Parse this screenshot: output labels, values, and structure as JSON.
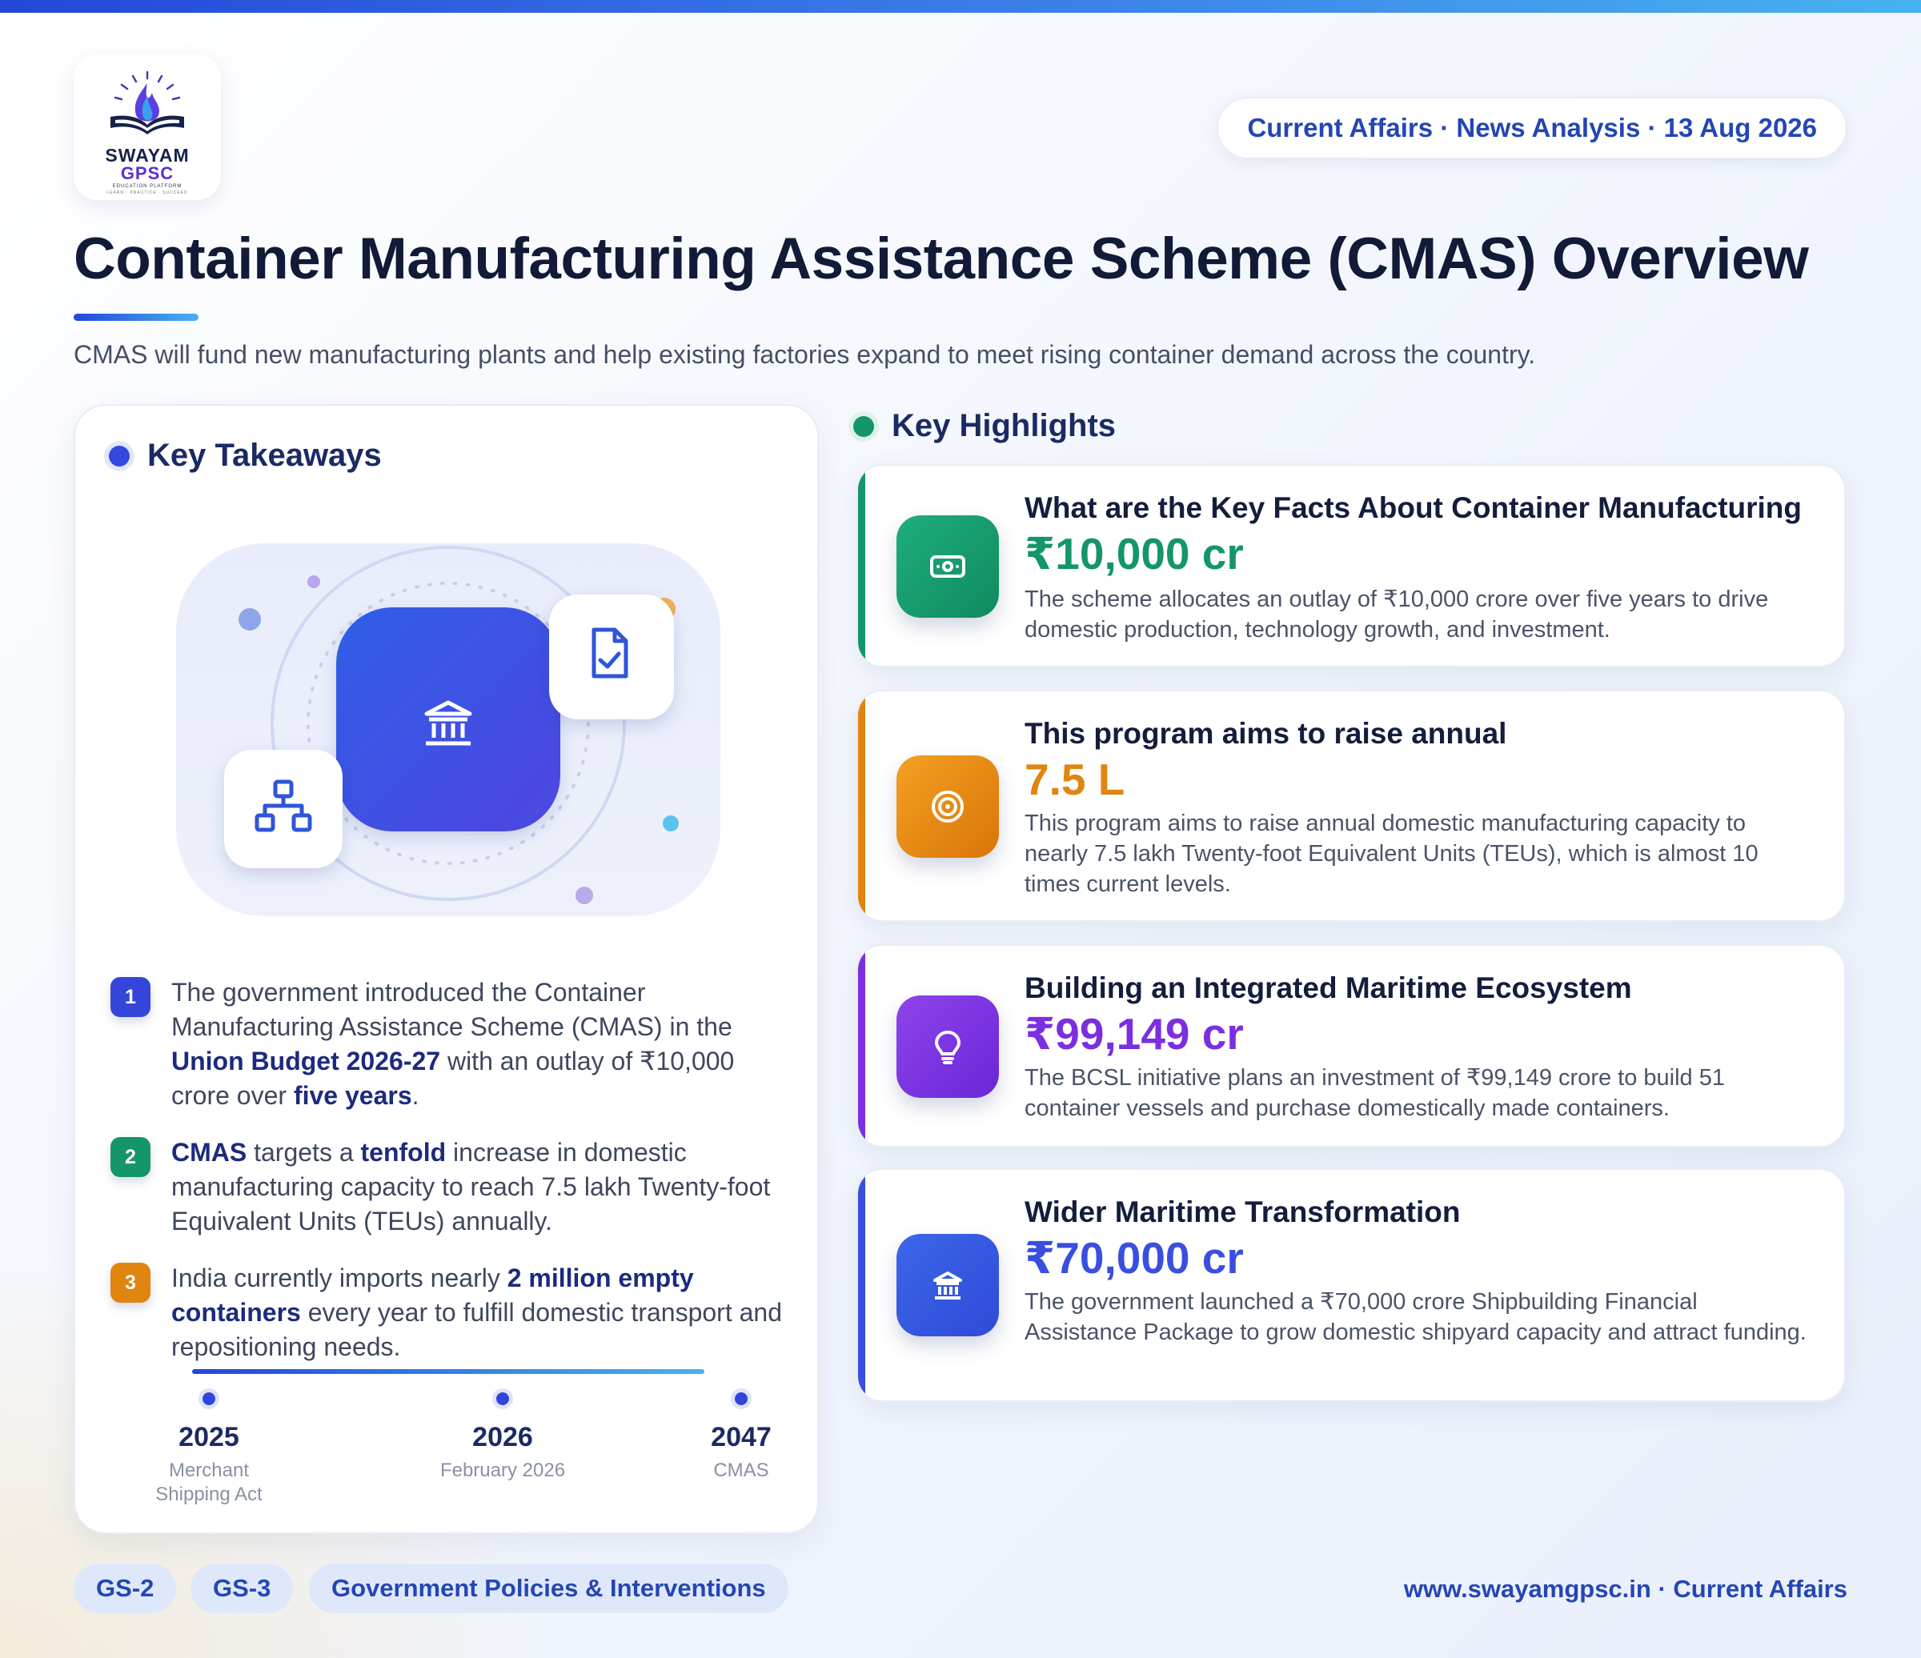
{
  "header": {
    "logo": {
      "line1": "SWAYAM",
      "line2": "GPSC",
      "line3": "EDUCATION PLATFORM",
      "line4": "LEARN · PRACTICE · SUCCEED"
    },
    "date_pill": "Current Affairs · News Analysis · 13 Aug 2026"
  },
  "page": {
    "title": "Container Manufacturing Assistance Scheme (CMAS) Overview",
    "subtitle": "CMAS will fund new manufacturing plants and help existing factories expand to meet rising container demand across the country."
  },
  "takeaways": {
    "heading": "Key Takeaways",
    "items": [
      {
        "num": "1",
        "t1": "The government introduced the Container Manufacturing Assistance Scheme (CMAS) in the ",
        "b1": "Union Budget 2026-27",
        "t2": " with an outlay of ₹10,000 crore over ",
        "b2": "five years",
        "t3": "."
      },
      {
        "num": "2",
        "b1": "CMAS",
        "t1": " targets a ",
        "b2": "tenfold",
        "t2": " increase in domestic manufacturing capacity to reach 7.5 lakh Twenty-foot Equivalent Units (TEUs) annually."
      },
      {
        "num": "3",
        "t1": "India currently imports nearly ",
        "b1": "2 million empty containers",
        "t2": " every year to fulfill domestic transport and repositioning needs."
      }
    ],
    "timeline": [
      {
        "year": "2025",
        "caption": "Merchant Shipping Act"
      },
      {
        "year": "2026",
        "caption": "February 2026"
      },
      {
        "year": "2047",
        "caption": "CMAS"
      }
    ]
  },
  "highlights": {
    "heading": "Key Highlights",
    "cards": [
      {
        "title": "What are the Key Facts About Container Manufacturing",
        "value": "₹10,000 cr",
        "desc": "The scheme allocates an outlay of ₹10,000 crore over five years to drive domestic production, technology growth, and investment.",
        "icon": "money-icon",
        "color": "#14956a"
      },
      {
        "title": "This program aims to raise annual",
        "value": "7.5 L",
        "desc": "This program aims to raise annual domestic manufacturing capacity to nearly 7.5 lakh Twenty-foot Equivalent Units (TEUs), which is almost 10 times current levels.",
        "icon": "target-icon",
        "color": "#e0850f"
      },
      {
        "title": "Building an Integrated Maritime Ecosystem",
        "value": "₹99,149 cr",
        "desc": "The BCSL initiative plans an investment of ₹99,149 crore to build 51 container vessels and purchase domestically made containers.",
        "icon": "lightbulb-icon",
        "color": "#7b2fe0"
      },
      {
        "title": "Wider Maritime Transformation",
        "value": "₹70,000 cr",
        "desc": "The government launched a ₹70,000 crore Shipbuilding Financial Assistance Package to grow domestic shipyard capacity and attract funding.",
        "icon": "bank-icon",
        "color": "#3a4ee0"
      }
    ]
  },
  "footer": {
    "tags": [
      "GS-2",
      "GS-3",
      "Government Policies & Interventions"
    ],
    "site": "www.swayamgpsc.in · Current Affairs"
  }
}
